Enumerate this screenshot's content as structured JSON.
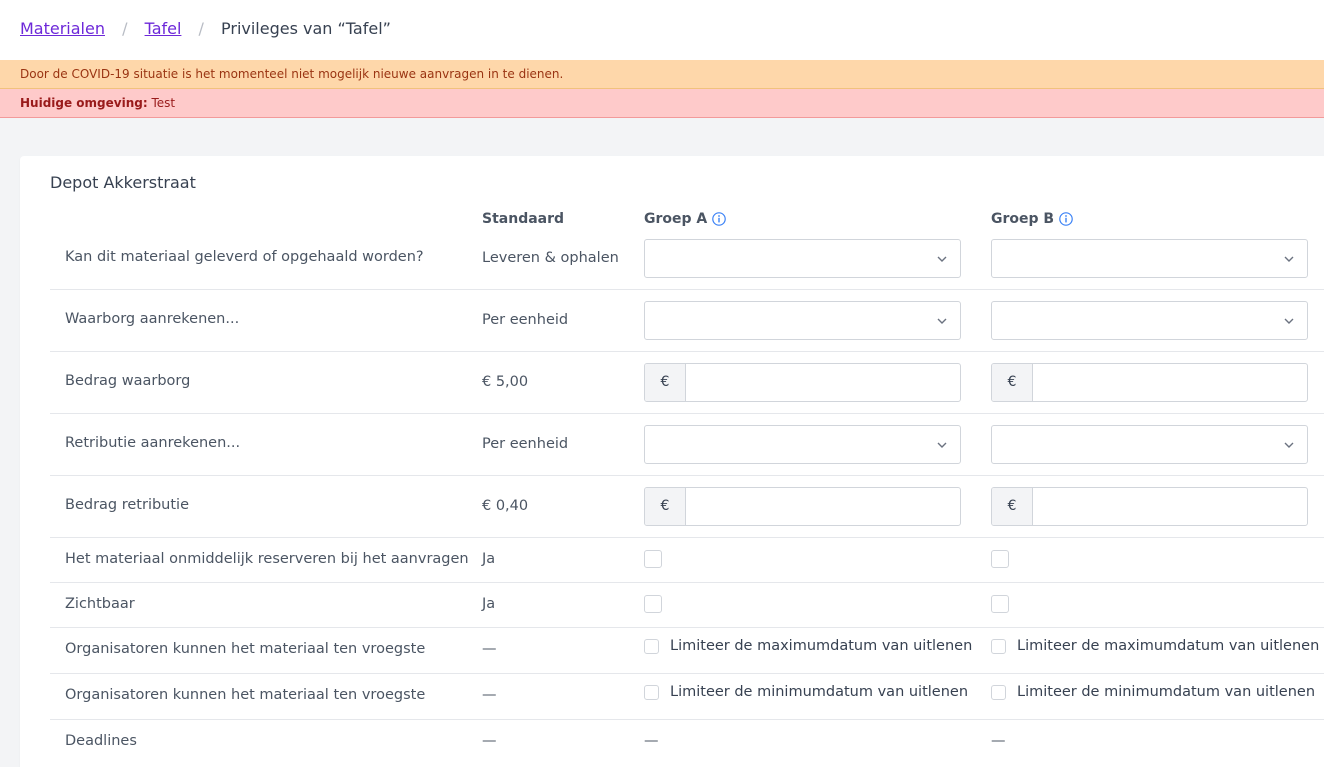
{
  "breadcrumb": {
    "items": [
      "Materialen",
      "Tafel"
    ],
    "separator": "/",
    "current": "Privileges van “Tafel”"
  },
  "alerts": {
    "covid": "Door de COVID-19 situatie is het momenteel niet mogelijk nieuwe aanvragen in te dienen.",
    "env_label": "Huidige omgeving:",
    "env_value": "Test"
  },
  "card": {
    "title": "Depot Akkerstraat",
    "columns": {
      "standard": "Standaard",
      "group_a": "Groep A",
      "group_b": "Groep B"
    },
    "rows": [
      {
        "label": "Kan dit materiaal geleverd of opgehaald worden?",
        "standard": "Leveren & ophalen"
      },
      {
        "label": "Waarborg aanrekenen...",
        "standard": "Per eenheid"
      },
      {
        "label": "Bedrag waarborg",
        "standard": "€ 5,00",
        "currency": "€"
      },
      {
        "label": "Retributie aanrekenen...",
        "standard": "Per eenheid"
      },
      {
        "label": "Bedrag retributie",
        "standard": "€ 0,40",
        "currency": "€"
      },
      {
        "label": "Het materiaal onmiddelijk reserveren bij het aanvragen",
        "standard": "Ja"
      },
      {
        "label": "Zichtbaar",
        "standard": "Ja"
      },
      {
        "label": "Organisatoren kunnen het materiaal ten vroegste",
        "standard": "—",
        "checkbox_label": "Limiteer de maximumdatum van uitlenen"
      },
      {
        "label": "Organisatoren kunnen het materiaal ten vroegste",
        "standard": "—",
        "checkbox_label": "Limiteer de minimumdatum van uitlenen"
      },
      {
        "label": "Deadlines",
        "standard": "—",
        "group_a": "—",
        "group_b": "—"
      }
    ]
  },
  "colors": {
    "link": "#6d28d9",
    "warning_bg": "#fed7aa",
    "danger_bg": "#fecaca",
    "info_icon": "#3b82f6"
  },
  "icons": [
    "info-icon",
    "chevron-down-icon"
  ]
}
